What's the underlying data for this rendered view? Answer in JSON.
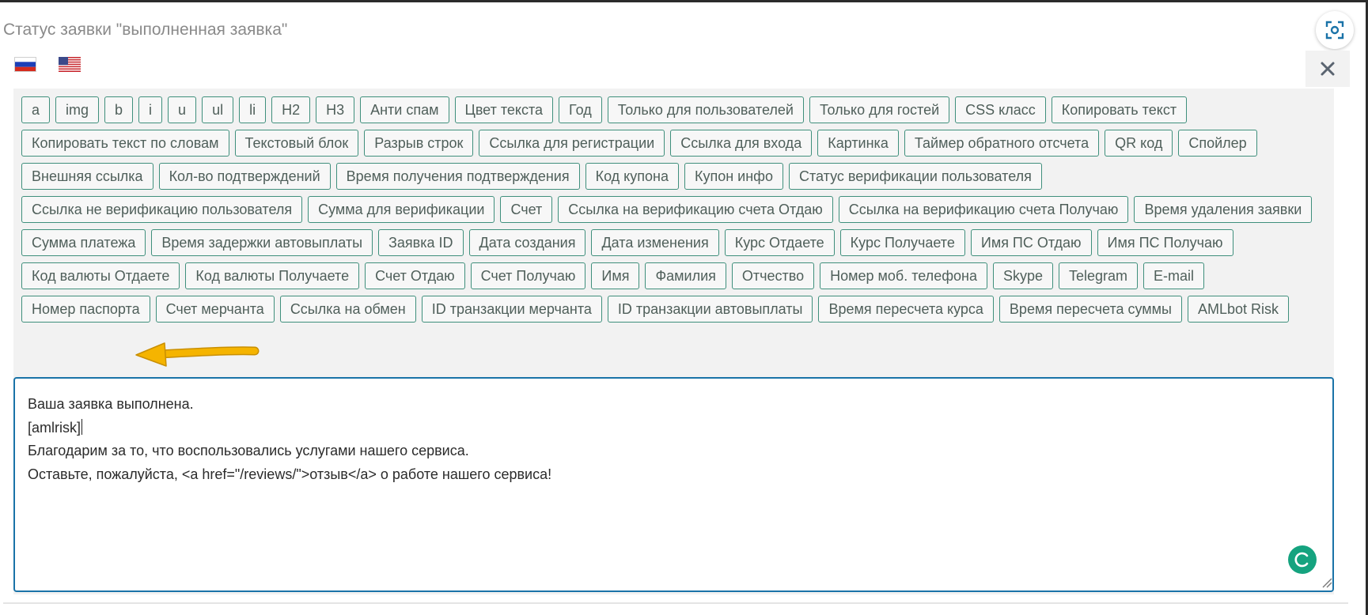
{
  "section_title": "Статус заявки \"выполненная заявка\"",
  "languages": [
    {
      "code": "ru",
      "icon": "flag-ru-icon",
      "active": true
    },
    {
      "code": "en",
      "icon": "flag-us-icon",
      "active": false
    }
  ],
  "toolbar": {
    "buttons": [
      "a",
      "img",
      "b",
      "i",
      "u",
      "ul",
      "li",
      "H2",
      "H3",
      "Анти спам",
      "Цвет текста",
      "Год",
      "Только для пользователей",
      "Только для гостей",
      "CSS класс",
      "Копировать текст",
      "Копировать текст по словам",
      "Текстовый блок",
      "Разрыв строк",
      "Ссылка для регистрации",
      "Ссылка для входа",
      "Картинка",
      "Таймер обратного отсчета",
      "QR код",
      "Спойлер",
      "Внешняя ссылка",
      "Кол-во подтверждений",
      "Время получения подтверждения",
      "Код купона",
      "Купон инфо",
      "Статус верификации пользователя",
      "Ссылка не верификацию пользователя",
      "Сумма для верификации",
      "Счет",
      "Ссылка на верификацию счета Отдаю",
      "Ссылка на верификацию счета Получаю",
      "Время удаления заявки",
      "Сумма платежа",
      "Время задержки автовыплаты",
      "Заявка ID",
      "Дата создания",
      "Дата изменения",
      "Курс Отдаете",
      "Курс Получаете",
      "Имя ПС Отдаю",
      "Имя ПС Получаю",
      "Код валюты Отдаете",
      "Код валюты Получаете",
      "Счет Отдаю",
      "Счет Получаю",
      "Имя",
      "Фамилия",
      "Отчество",
      "Номер моб. телефона",
      "Skype",
      "Telegram",
      "E-mail",
      "Номер паспорта",
      "Счет мерчанта",
      "Ссылка на обмен",
      "ID транзакции мерчанта",
      "ID транзакции автовыплаты",
      "Время пересчета курса",
      "Время пересчета суммы",
      "AMLbot Risk"
    ]
  },
  "editor": {
    "lines": [
      "Ваша заявка выполнена.",
      "[amlrisk]",
      "Благодарим за то, что воспользовались услугами нашего сервиса.",
      "Оставьте, пожалуйста, <a href=\"/reviews/\">отзыв</a> о работе нашего сервиса!"
    ]
  },
  "colors": {
    "button_border": "#3f8f7c",
    "editor_border": "#1a73a8",
    "arrow": "#f5b400",
    "grammar_badge": "#15a37f"
  },
  "icons": {
    "focus": "screenshot-focus-icon",
    "close": "close-icon",
    "arrow": "arrow-annotation-icon",
    "grammar": "grammar-assistant-icon",
    "resize": "resize-handle-icon"
  }
}
